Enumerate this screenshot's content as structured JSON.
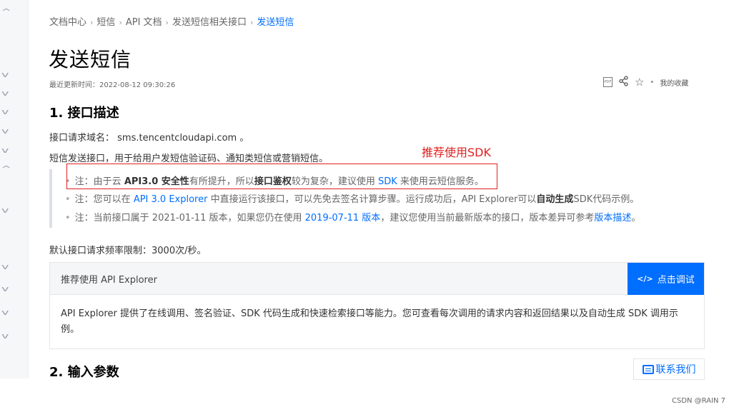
{
  "breadcrumb": {
    "items": [
      "文档中心",
      "短信",
      "API 文档",
      "发送短信相关接口",
      "发送短信"
    ],
    "separator": "›"
  },
  "page": {
    "title": "发送短信",
    "updated": "最近更新时间：2022-08-12 09:30:26"
  },
  "tools": {
    "pdf_label": "PDF",
    "favorite_label": "我的收藏"
  },
  "section1": {
    "heading": "1. 接口描述",
    "domain_text": "接口请求域名： sms.tencentcloudapi.com 。",
    "desc_text": "短信发送接口，用于给用户发短信验证码、通知类短信或营销短信。",
    "notes": {
      "n1": {
        "p1": "注：由于云 ",
        "b1": "API3.0 安全性",
        "p2": "有所提升，所以",
        "b2": "接口鉴权",
        "p3": "较为复杂，建议使用 ",
        "link": "SDK",
        "p4": " 来使用云短信服务。"
      },
      "n2": {
        "p1": "注：您可以在 ",
        "link": "API 3.0 Explorer",
        "p2": " 中直接运行该接口，可以先免去签名计算步骤。运行成功后，API Explorer可以",
        "b1": "自动生成",
        "p3": "SDK代码示例。"
      },
      "n3": {
        "p1": "注：当前接口属于 2021-01-11 版本，如果您仍在使用 ",
        "link1": "2019-07-11 版本",
        "p2": "，建议您使用当前最新版本的接口，版本差异可参考",
        "link2": "版本描述",
        "p3": "。"
      }
    },
    "rate_limit": "默认接口请求频率限制：3000次/秒。"
  },
  "annotation": {
    "text": "推荐使用SDK",
    "color": "#e02020"
  },
  "explorer": {
    "title": "推荐使用 API Explorer",
    "button_icon": "</>",
    "button_label": "点击调试",
    "body_line1": "API Explorer 提供了在线调用、签名验证、SDK 代码生成和快速检索接口等能力。您可查看每次调用的请求内容和返回结果以及自动生成 SDK 调用示",
    "body_line2": "例。"
  },
  "section2": {
    "heading": "2. 输入参数"
  },
  "contact": {
    "label": "联系我们"
  },
  "watermark": "CSDN @RAIN 7",
  "colors": {
    "accent": "#006eff",
    "annotation": "#e02020"
  }
}
